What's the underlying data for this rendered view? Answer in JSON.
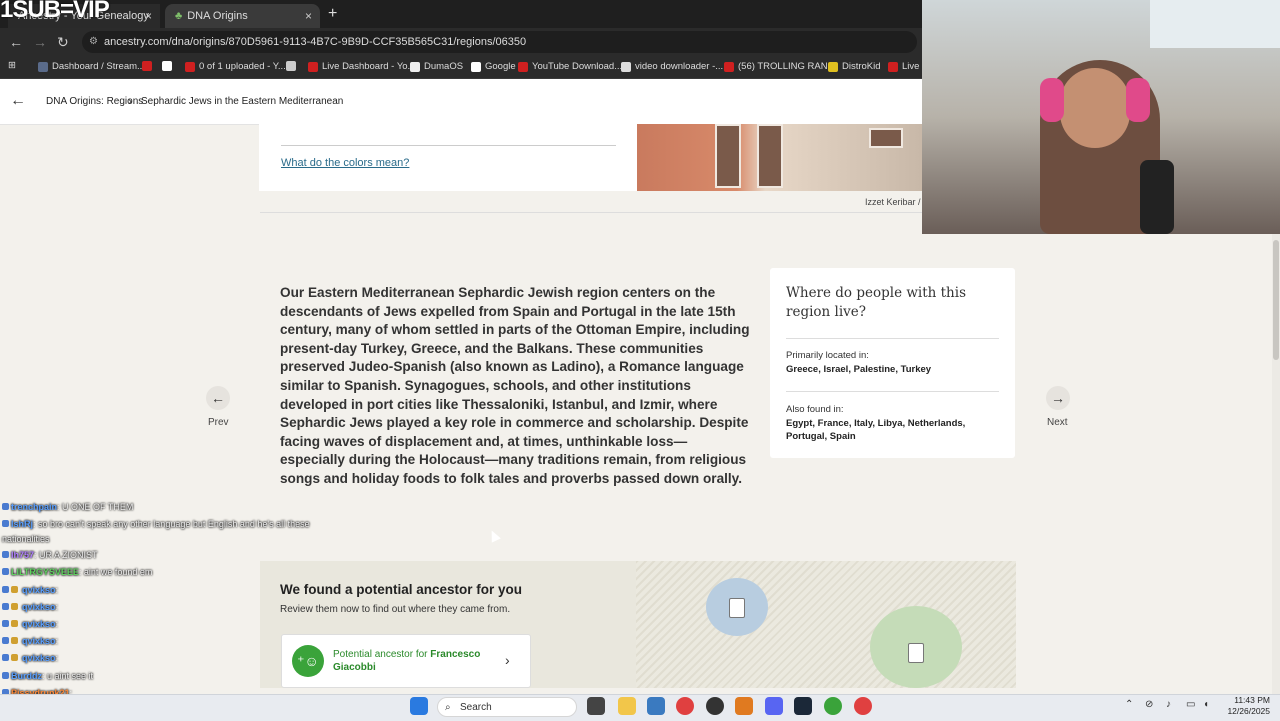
{
  "overlay": {
    "title": "1SUB=VIP"
  },
  "browser": {
    "tabs": [
      {
        "label": "Ancestry - Your Genealogy",
        "close": "×"
      },
      {
        "label": "DNA Origins",
        "close": "×"
      }
    ],
    "new_tab": "+",
    "url": "ancestry.com/dna/origins/870D5961-9113-4B7C-9B9D-CCF35B565C31/regions/06350",
    "bookmarks": [
      {
        "label": "Dashboard / Stream...",
        "color": "#5a6b8a"
      },
      {
        "label": "",
        "color": "#d02020"
      },
      {
        "label": "",
        "color": "#ffffff"
      },
      {
        "label": "0 of 1 uploaded - Y...",
        "color": "#d02020"
      },
      {
        "label": "",
        "color": "#cccccc"
      },
      {
        "label": "Live Dashboard - Yo...",
        "color": "#d02020"
      },
      {
        "label": "DumaOS",
        "color": "#eeeeee"
      },
      {
        "label": "Google",
        "color": "#ffffff"
      },
      {
        "label": "YouTube Download...",
        "color": "#d02020"
      },
      {
        "label": "video downloader -...",
        "color": "#dddddd"
      },
      {
        "label": "(56) TROLLING RAN...",
        "color": "#d02020"
      },
      {
        "label": "DistroKid",
        "color": "#e0c020"
      },
      {
        "label": "Live Da",
        "color": "#d02020"
      }
    ]
  },
  "header": {
    "crumb1": "DNA Origins: Regions",
    "crumb_sep": "›",
    "crumb2": "Sephardic Jews in the Eastern Mediterranean"
  },
  "top": {
    "colors_link": "What do the colors mean?",
    "credit": "Izzet Keribar /"
  },
  "main": {
    "text": "Our Eastern Mediterranean Sephardic Jewish region centers on the descendants of Jews expelled from Spain and Portugal in the late 15th century, many of whom settled in parts of the Ottoman Empire, including present-day Turkey, Greece, and the Balkans. These communities preserved Judeo-Spanish (also known as Ladino), a Romance language similar to Spanish. Synagogues, schools, and other institutions developed in port cities like Thessaloniki, Istanbul, and Izmir, where Sephardic Jews played a key role in commerce and scholarship. Despite facing waves of displacement and, at times, unthinkable loss—especially during the Holocaust—many traditions remain, from religious songs and holiday foods to folk tales and proverbs passed down orally.",
    "prev_label": "Prev",
    "next_label": "Next",
    "prev_icon": "←",
    "next_icon": "→"
  },
  "side": {
    "heading": "Where do people with this region live?",
    "primary_label": "Primarily located in:",
    "primary_value": "Greece, Israel, Palestine, Turkey",
    "also_label": "Also found in:",
    "also_value": "Egypt, France, Italy, Libya, Netherlands, Portugal, Spain"
  },
  "ancestor": {
    "title": "We found a potential ancestor for you",
    "subtitle": "Review them now to find out where they came from.",
    "card_prefix": "Potential ancestor for ",
    "card_name": "Francesco Giacobbi",
    "chevron": "›"
  },
  "chat": [
    {
      "name": "trenchpain",
      "msg": ": U ONE OF THEM",
      "color": "#5aa0ff"
    },
    {
      "name": "IshRj",
      "msg": ": so bro can't speak any other language but English and he's all these",
      "color": "#5aa0ff"
    },
    {
      "name": "",
      "msg": "nationalities",
      "color": "#eeeeee"
    },
    {
      "name": "Ih757",
      "msg": ": UR A ZIONIST",
      "color": "#b080ff"
    },
    {
      "name": "LILTRGYSVEEE",
      "msg": ": aint we found em",
      "color": "#60d060"
    },
    {
      "name": "qvixkso",
      "msg": ":",
      "color": "#5aa0ff"
    },
    {
      "name": "qvixkso",
      "msg": ":",
      "color": "#5aa0ff"
    },
    {
      "name": "qvixkso",
      "msg": ":",
      "color": "#5aa0ff"
    },
    {
      "name": "qvixkso",
      "msg": ":",
      "color": "#5aa0ff"
    },
    {
      "name": "qvixkso",
      "msg": ":",
      "color": "#5aa0ff"
    },
    {
      "name": "Burddz",
      "msg": ": u aint see it",
      "color": "#5aa0ff"
    },
    {
      "name": "Pissydrunk21",
      "msg": ":",
      "color": "#ff8a3a"
    }
  ],
  "taskbar": {
    "search": "Search",
    "time": "11:43 PM",
    "date": "12/26/2025"
  }
}
